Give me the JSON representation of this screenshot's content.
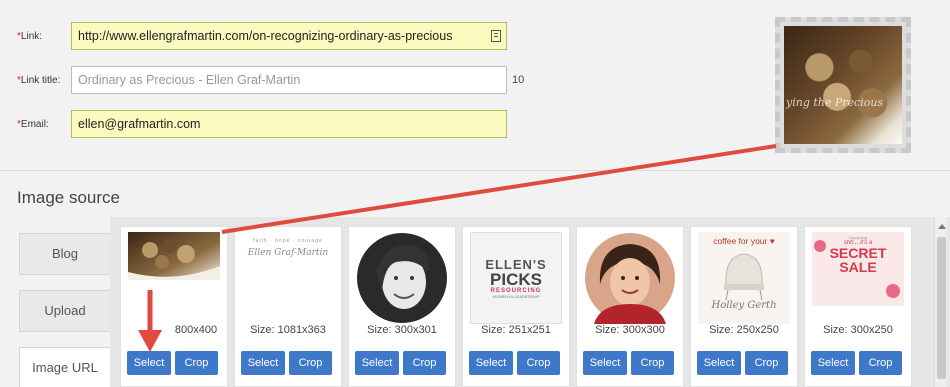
{
  "form": {
    "link": {
      "label": "Link:",
      "value": "http://www.ellengrafmartin.com/on-recognizing-ordinary-as-precious"
    },
    "link_title": {
      "label": "Link title:",
      "placeholder": "Ordinary as Precious - Ellen Graf-Martin",
      "count": "10"
    },
    "email": {
      "label": "Email:",
      "value": "ellen@grafmartin.com"
    },
    "required_mark": "*"
  },
  "preview": {
    "caption": "ying the Precious"
  },
  "image_source": {
    "title": "Image source",
    "tabs": [
      {
        "label": "Blog"
      },
      {
        "label": "Upload"
      },
      {
        "label": "Image URL"
      }
    ]
  },
  "gallery": {
    "select_label": "Select",
    "crop_label": "Crop",
    "images": [
      {
        "size": "800x400",
        "icon": "food-photo"
      },
      {
        "size": "Size: 1081x363",
        "icon": "signature-banner",
        "top_text": "faith · hope · courage",
        "sig": "Ellen Graf-Martin"
      },
      {
        "size": "Size: 300x301",
        "icon": "portrait-bw"
      },
      {
        "size": "Size: 251x251",
        "icon": "ellens-picks-logo",
        "logo_l1": "ELLEN'S",
        "logo_l2": "PICKS",
        "logo_l3": "RESOURCING",
        "logo_l4": "WOMEN IN LEADERSHIP"
      },
      {
        "size": "Size: 300x300",
        "icon": "portrait-color"
      },
      {
        "size": "Size: 250x250",
        "icon": "coffee-chair",
        "t1": "coffee for your",
        "t2": "Holley Gerth"
      },
      {
        "size": "Size: 300x250",
        "icon": "secret-sale",
        "t1": "SECRET",
        "t2": "SALE",
        "t3": "Dayspring",
        "t4": "shh... it's a"
      }
    ]
  },
  "colors": {
    "accent": "#3e78c9",
    "highlight": "#fbfbbf",
    "annotation": "#e04a3f"
  }
}
